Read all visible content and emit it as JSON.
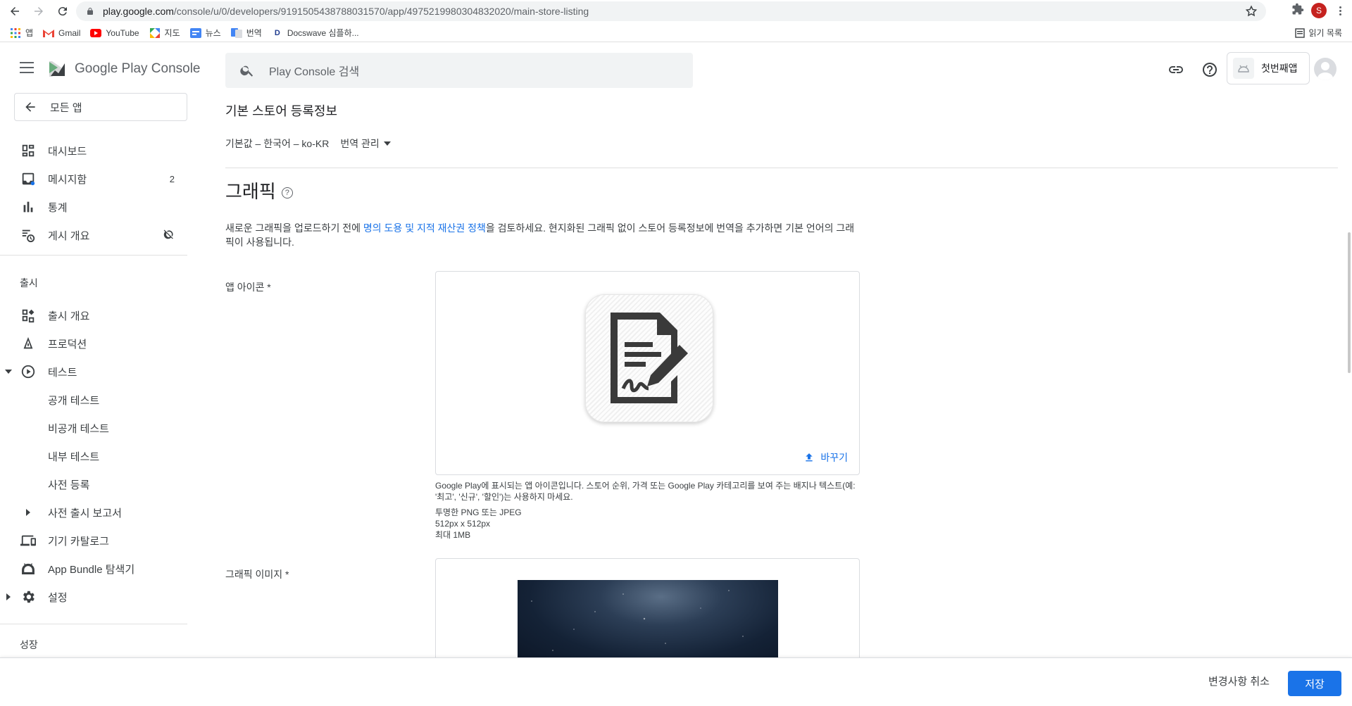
{
  "browser": {
    "url_host": "play.google.com",
    "url_path": "/console/u/0/developers/9191505438788031570/app/4975219980304832020/main-store-listing",
    "profile_initial": "S",
    "bookmarks": [
      {
        "label": "앱"
      },
      {
        "label": "Gmail"
      },
      {
        "label": "YouTube"
      },
      {
        "label": "지도"
      },
      {
        "label": "뉴스"
      },
      {
        "label": "번역"
      },
      {
        "label": "Docswave 심플하..."
      }
    ],
    "reading_list": "읽기 목록"
  },
  "header": {
    "logo_text": "Google Play Console",
    "search_placeholder": "Play Console 검색",
    "app_name": "첫번째앱"
  },
  "sidebar": {
    "back_label": "모든 앱",
    "items": [
      {
        "label": "대시보드"
      },
      {
        "label": "메시지함",
        "badge": "2"
      },
      {
        "label": "통계"
      },
      {
        "label": "게시 개요"
      }
    ],
    "release_section": "출시",
    "release_items": [
      {
        "label": "출시 개요"
      },
      {
        "label": "프로덕션"
      },
      {
        "label": "테스트"
      },
      {
        "label": "공개 테스트"
      },
      {
        "label": "비공개 테스트"
      },
      {
        "label": "내부 테스트"
      },
      {
        "label": "사전 등록"
      },
      {
        "label": "사전 출시 보고서"
      },
      {
        "label": "기기 카탈로그"
      },
      {
        "label": "App Bundle 탐색기"
      },
      {
        "label": "설정"
      }
    ],
    "growth_section": "성장"
  },
  "main": {
    "page_title": "기본 스토어 등록정보",
    "default_lang": "기본값 – 한국어 – ko-KR",
    "manage_translations": "번역 관리",
    "section_title": "그래픽",
    "desc_before": "새로운 그래픽을 업로드하기 전에 ",
    "desc_link": "명의 도용 및 지적 재산권 정책",
    "desc_after": "을 검토하세요. 현지화된 그래픽 없이 스토어 등록정보에 번역을 추가하면 기본 언어의 그래픽이 사용됩니다.",
    "app_icon_label": "앱 아이콘 *",
    "replace_label": "바꾸기",
    "icon_help": "Google Play에 표시되는 앱 아이콘입니다. 스토어 순위, 가격 또는 Google Play 카테고리를 보여 주는 배지나 텍스트(예: '최고', '신규', '할인')는 사용하지 마세요.",
    "icon_spec_1": "투명한 PNG 또는 JPEG",
    "icon_spec_2": "512px x 512px",
    "icon_spec_3": "최대 1MB",
    "feature_label": "그래픽 이미지 *"
  },
  "footer": {
    "discard_label": "변경사항 취소",
    "save_label": "저장"
  },
  "colors": {
    "accent": "#1a73e8",
    "profile": "#c5221f"
  }
}
